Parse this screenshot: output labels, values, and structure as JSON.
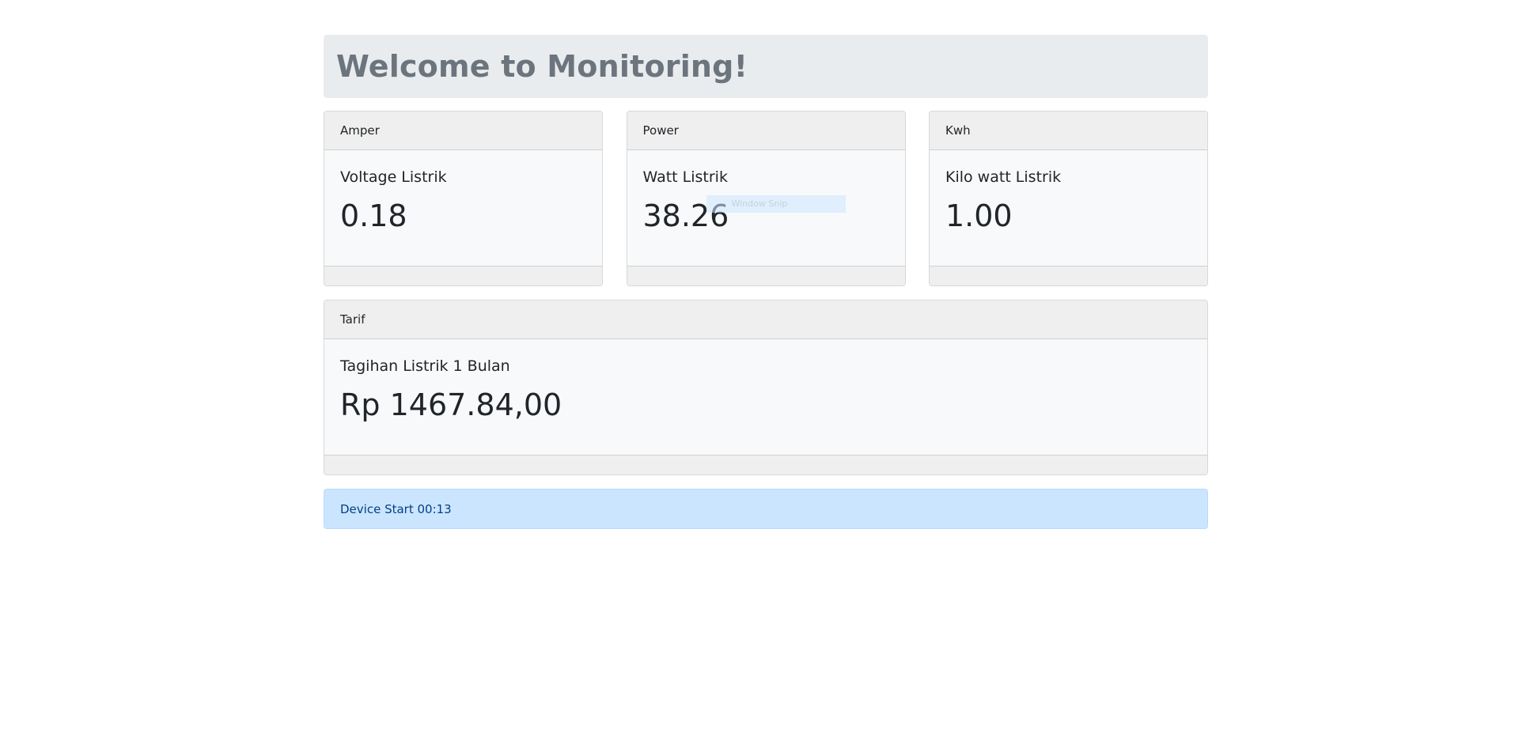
{
  "jumbotron": {
    "title": "Welcome to Monitoring!"
  },
  "cards": [
    {
      "header": "Amper",
      "title": "Voltage Listrik",
      "value": "0.18"
    },
    {
      "header": "Power",
      "title": "Watt Listrik",
      "value": "38.26"
    },
    {
      "header": "Kwh",
      "title": "Kilo watt Listrik",
      "value": "1.00"
    }
  ],
  "tarif": {
    "header": "Tarif",
    "title": "Tagihan Listrik 1 Bulan",
    "value": "Rp 1467.84,00"
  },
  "snip_overlay": {
    "label": "Window Snip"
  },
  "alert": {
    "text": "Device Start 00:13"
  },
  "colors": {
    "jumbotron_bg": "#e9ecef",
    "jumbotron_text": "#6c757d",
    "card_bg": "#f8f9fa",
    "card_header_bg": "#efefef",
    "alert_bg": "#cce5ff",
    "alert_text": "#004085"
  }
}
